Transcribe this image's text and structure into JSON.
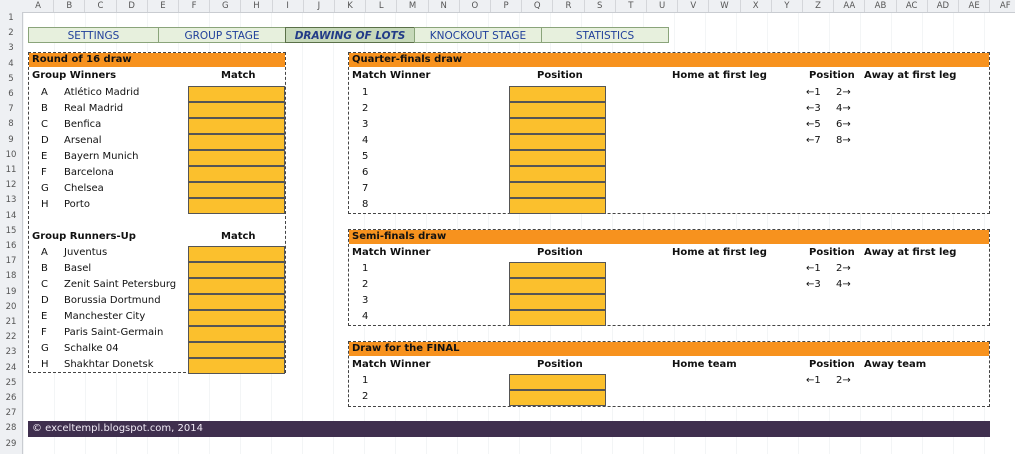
{
  "columns": [
    "A",
    "B",
    "C",
    "D",
    "E",
    "F",
    "G",
    "H",
    "I",
    "J",
    "K",
    "L",
    "M",
    "N",
    "O",
    "P",
    "Q",
    "R",
    "S",
    "T",
    "U",
    "V",
    "W",
    "X",
    "Y",
    "Z",
    "AA",
    "AB",
    "AC",
    "AD",
    "AE",
    "AF"
  ],
  "rows": [
    "1",
    "2",
    "3",
    "4",
    "5",
    "6",
    "7",
    "8",
    "9",
    "10",
    "11",
    "12",
    "13",
    "14",
    "15",
    "16",
    "17",
    "18",
    "19",
    "20",
    "21",
    "22",
    "23",
    "24",
    "25",
    "26",
    "27",
    "28",
    "29"
  ],
  "tabs": [
    "SETTINGS",
    "GROUP STAGE",
    "DRAWING OF LOTS",
    "KNOCKOUT STAGE",
    "STATISTICS"
  ],
  "r16": {
    "title": "Round of 16 draw",
    "winners_header": "Group Winners",
    "runners_header": "Group Runners-Up",
    "match_header": "Match",
    "winners": [
      {
        "group": "A",
        "team": "Atlético Madrid"
      },
      {
        "group": "B",
        "team": "Real Madrid"
      },
      {
        "group": "C",
        "team": "Benfica"
      },
      {
        "group": "D",
        "team": "Arsenal"
      },
      {
        "group": "E",
        "team": "Bayern Munich"
      },
      {
        "group": "F",
        "team": "Barcelona"
      },
      {
        "group": "G",
        "team": "Chelsea"
      },
      {
        "group": "H",
        "team": "Porto"
      }
    ],
    "runners": [
      {
        "group": "A",
        "team": "Juventus"
      },
      {
        "group": "B",
        "team": "Basel"
      },
      {
        "group": "C",
        "team": "Zenit Saint Petersburg"
      },
      {
        "group": "D",
        "team": "Borussia Dortmund"
      },
      {
        "group": "E",
        "team": "Manchester City"
      },
      {
        "group": "F",
        "team": "Paris Saint-Germain"
      },
      {
        "group": "G",
        "team": "Schalke 04"
      },
      {
        "group": "H",
        "team": "Shakhtar Donetsk"
      }
    ]
  },
  "qf": {
    "title": "Quarter-finals draw",
    "headers": {
      "winner": "Match Winner",
      "position": "Position",
      "home": "Home at first leg",
      "pos2": "Position",
      "away": "Away at first leg"
    },
    "rows": [
      "1",
      "2",
      "3",
      "4",
      "5",
      "6",
      "7",
      "8"
    ],
    "pairs": [
      [
        "←1",
        "2→"
      ],
      [
        "←3",
        "4→"
      ],
      [
        "←5",
        "6→"
      ],
      [
        "←7",
        "8→"
      ]
    ]
  },
  "sf": {
    "title": "Semi-finals draw",
    "headers": {
      "winner": "Match Winner",
      "position": "Position",
      "home": "Home at first leg",
      "pos2": "Position",
      "away": "Away at first leg"
    },
    "rows": [
      "1",
      "2",
      "3",
      "4"
    ],
    "pairs": [
      [
        "←1",
        "2→"
      ],
      [
        "←3",
        "4→"
      ]
    ]
  },
  "final": {
    "title": "Draw for the FINAL",
    "headers": {
      "winner": "Match Winner",
      "position": "Position",
      "home": "Home team",
      "pos2": "Position",
      "away": "Away team"
    },
    "rows": [
      "1",
      "2"
    ],
    "pairs": [
      [
        "←1",
        "2→"
      ]
    ]
  },
  "footer": "© exceltempl.blogspot.com, 2014",
  "colors": {
    "accent": "#f7921e",
    "cell": "#fbc02d",
    "tab": "#e7f0dd",
    "footer": "#3f2f4e"
  }
}
